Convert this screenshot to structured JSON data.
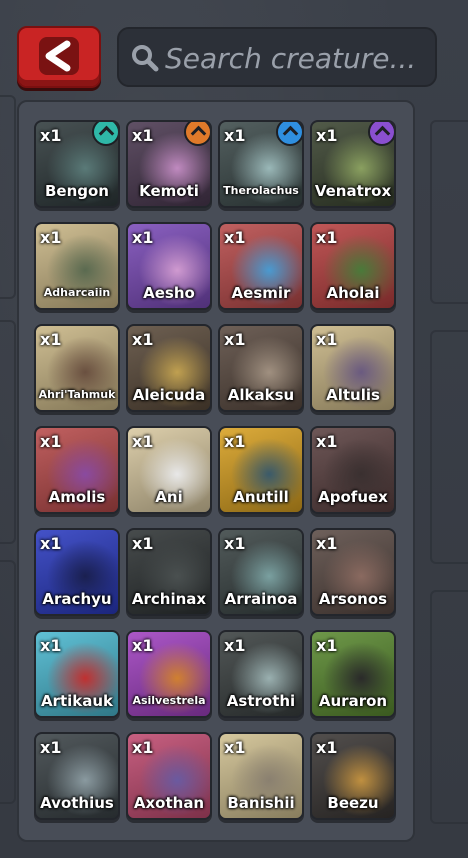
{
  "header": {
    "back_label": "<",
    "search_placeholder": "Search creature..."
  },
  "colors": {
    "back_button": "#c92424",
    "badge_teal": "#2fb8a8",
    "badge_orange": "#e07a2a",
    "badge_blue": "#2f8fe0",
    "badge_purple": "#8a4fd0"
  },
  "creatures": [
    {
      "name": "Bengon",
      "qty": "x1",
      "bg": "#2f3a3c",
      "accent": "#5a7a78",
      "badge": "badge-teal"
    },
    {
      "name": "Kemoti",
      "qty": "x1",
      "bg": "#4a3850",
      "accent": "#c08ac0",
      "badge": "badge-orange"
    },
    {
      "name": "Therolachus",
      "qty": "x1",
      "bg": "#3c4a4a",
      "accent": "#9ab8b8",
      "badge": "badge-blue"
    },
    {
      "name": "Venatrox",
      "qty": "x1",
      "bg": "#3a4430",
      "accent": "#8aa060",
      "badge": "badge-purple"
    },
    {
      "name": "Adharcaiin",
      "qty": "x1",
      "bg": "#c9b685",
      "accent": "#5a6a50",
      "badge": ""
    },
    {
      "name": "Aesho",
      "qty": "x1",
      "bg": "#7a4ab8",
      "accent": "#d09ad0",
      "badge": ""
    },
    {
      "name": "Aesmir",
      "qty": "x1",
      "bg": "#b84a4a",
      "accent": "#4a9ad0",
      "badge": ""
    },
    {
      "name": "Aholai",
      "qty": "x1",
      "bg": "#b84040",
      "accent": "#4a7a3a",
      "badge": ""
    },
    {
      "name": "Ahri'Tahmuk",
      "qty": "x1",
      "bg": "#c9b685",
      "accent": "#6a5040",
      "badge": ""
    },
    {
      "name": "Aleicuda",
      "qty": "x1",
      "bg": "#5a4a3a",
      "accent": "#c0a050",
      "badge": ""
    },
    {
      "name": "Alkaksu",
      "qty": "x1",
      "bg": "#5a4a40",
      "accent": "#a09080",
      "badge": ""
    },
    {
      "name": "Altulis",
      "qty": "x1",
      "bg": "#c9b685",
      "accent": "#6a5a80",
      "badge": ""
    },
    {
      "name": "Amolis",
      "qty": "x1",
      "bg": "#b84a4a",
      "accent": "#8a4aa0",
      "badge": ""
    },
    {
      "name": "Ani",
      "qty": "x1",
      "bg": "#d8c8a0",
      "accent": "#e8e8e8",
      "badge": ""
    },
    {
      "name": "Anutill",
      "qty": "x1",
      "bg": "#d8a020",
      "accent": "#3a5a6a",
      "badge": ""
    },
    {
      "name": "Apofuex",
      "qty": "x1",
      "bg": "#5a4040",
      "accent": "#3a3030",
      "badge": ""
    },
    {
      "name": "Arachyu",
      "qty": "x1",
      "bg": "#2a3ac0",
      "accent": "#1a2050",
      "badge": ""
    },
    {
      "name": "Archinax",
      "qty": "x1",
      "bg": "#2e3334",
      "accent": "#4a5050",
      "badge": ""
    },
    {
      "name": "Arrainoa",
      "qty": "x1",
      "bg": "#3a4444",
      "accent": "#7aa0a0",
      "badge": ""
    },
    {
      "name": "Arsonos",
      "qty": "x1",
      "bg": "#5a4a44",
      "accent": "#8a6a60",
      "badge": ""
    },
    {
      "name": "Artikauk",
      "qty": "x1",
      "bg": "#4ab8d0",
      "accent": "#c03030",
      "badge": ""
    },
    {
      "name": "Asilvestrela",
      "qty": "x1",
      "bg": "#a040c0",
      "accent": "#d08030",
      "badge": ""
    },
    {
      "name": "Astrothi",
      "qty": "x1",
      "bg": "#3a4040",
      "accent": "#9ab0b0",
      "badge": ""
    },
    {
      "name": "Auraron",
      "qty": "x1",
      "bg": "#5a8a30",
      "accent": "#2a2a2a",
      "badge": ""
    },
    {
      "name": "Avothius",
      "qty": "x1",
      "bg": "#3a4246",
      "accent": "#8a9aa0",
      "badge": ""
    },
    {
      "name": "Axothan",
      "qty": "x1",
      "bg": "#c04a70",
      "accent": "#6a5aa0",
      "badge": ""
    },
    {
      "name": "Banishii",
      "qty": "x1",
      "bg": "#d0c090",
      "accent": "#8a8070",
      "badge": ""
    },
    {
      "name": "Beezu",
      "qty": "x1",
      "bg": "#3a3634",
      "accent": "#c09040",
      "badge": ""
    }
  ]
}
